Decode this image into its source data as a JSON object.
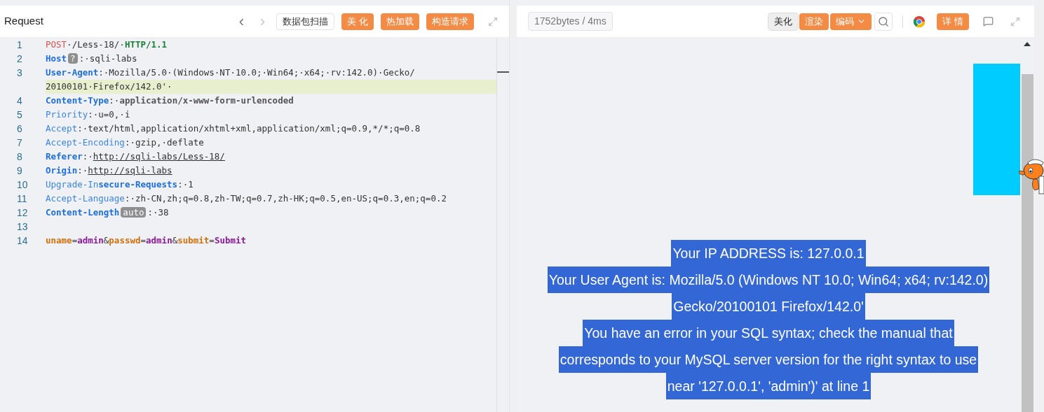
{
  "request": {
    "title": "Request",
    "nav": [
      {
        "label": "‹",
        "disabled": false
      },
      {
        "label": "›",
        "disabled": true
      }
    ],
    "buttons": [
      {
        "label": "数据包扫描",
        "kind": "outline"
      },
      {
        "label": "美 化",
        "kind": "primary"
      },
      {
        "label": "热加载",
        "kind": "primary"
      },
      {
        "label": "构造请求",
        "kind": "primary"
      }
    ],
    "lines": [
      {
        "number": "1",
        "rows": [
          {
            "highlighted": false,
            "segments": [
              {
                "kind": "method",
                "text": "POST"
              },
              {
                "kind": "value",
                "text": "·/Less-18/·"
              },
              {
                "kind": "keyword",
                "text": "HTTP/1.1"
              }
            ]
          }
        ]
      },
      {
        "number": "2",
        "rows": [
          {
            "highlighted": false,
            "segments": [
              {
                "kind": "header",
                "text": "Host"
              },
              {
                "kind": "badge",
                "text": "?"
              },
              {
                "kind": "value",
                "text": ":·sqli-labs"
              }
            ]
          }
        ]
      },
      {
        "number": "3",
        "rows": [
          {
            "highlighted": false,
            "segments": [
              {
                "kind": "header",
                "text": "User-Agent"
              },
              {
                "kind": "value",
                "text": ":·Mozilla/5.0·(Windows·NT·10.0;·Win64;·x64;·rv:142.0)·Gecko/"
              }
            ]
          },
          {
            "highlighted": true,
            "segments": [
              {
                "kind": "value",
                "text": "20100101·Firefox/142.0'·"
              }
            ]
          }
        ]
      },
      {
        "number": "4",
        "rows": [
          {
            "highlighted": false,
            "segments": [
              {
                "kind": "header",
                "text": "Content-Type"
              },
              {
                "kind": "value",
                "text": ":·"
              },
              {
                "kind": "strong",
                "text": "application/x-www-form-urlencoded"
              }
            ]
          }
        ]
      },
      {
        "number": "5",
        "rows": [
          {
            "highlighted": false,
            "segments": [
              {
                "kind": "header-light",
                "text": "Priority"
              },
              {
                "kind": "value",
                "text": ":·u=0,·i"
              }
            ]
          }
        ]
      },
      {
        "number": "6",
        "rows": [
          {
            "highlighted": false,
            "segments": [
              {
                "kind": "header-light",
                "text": "Accept"
              },
              {
                "kind": "value",
                "text": ":·text/html,application/xhtml+xml,application/xml;q=0.9,*/*;q=0.8"
              }
            ]
          }
        ]
      },
      {
        "number": "7",
        "rows": [
          {
            "highlighted": false,
            "segments": [
              {
                "kind": "header-light",
                "text": "Accept-Encoding"
              },
              {
                "kind": "value",
                "text": ":·gzip,·deflate"
              }
            ]
          }
        ]
      },
      {
        "number": "8",
        "rows": [
          {
            "highlighted": false,
            "segments": [
              {
                "kind": "header",
                "text": "Referer"
              },
              {
                "kind": "value",
                "text": ":·"
              },
              {
                "kind": "link",
                "text": "http://sqli-labs/Less-18/"
              }
            ]
          }
        ]
      },
      {
        "number": "9",
        "rows": [
          {
            "highlighted": false,
            "segments": [
              {
                "kind": "header",
                "text": "Origin"
              },
              {
                "kind": "value",
                "text": ":·"
              },
              {
                "kind": "link",
                "text": "http://sqli-labs"
              }
            ]
          }
        ]
      },
      {
        "number": "10",
        "rows": [
          {
            "highlighted": false,
            "segments": [
              {
                "kind": "header-light",
                "text": "Upgrade-In"
              },
              {
                "kind": "header",
                "text": "secure-Requests"
              },
              {
                "kind": "value",
                "text": ":·1"
              }
            ]
          }
        ]
      },
      {
        "number": "11",
        "rows": [
          {
            "highlighted": false,
            "segments": [
              {
                "kind": "header-light",
                "text": "Accept-Language"
              },
              {
                "kind": "value",
                "text": ":·zh-CN,zh;q=0.8,zh-TW;q=0.7,zh-HK;q=0.5,en-US;q=0.3,en;q=0.2"
              }
            ]
          }
        ]
      },
      {
        "number": "12",
        "rows": [
          {
            "highlighted": false,
            "segments": [
              {
                "kind": "header",
                "text": "Content-Length"
              },
              {
                "kind": "badge",
                "text": "auto"
              },
              {
                "kind": "value",
                "text": ":·38"
              }
            ]
          }
        ]
      },
      {
        "number": "13",
        "rows": [
          {
            "highlighted": false,
            "segments": []
          }
        ]
      },
      {
        "number": "14",
        "rows": [
          {
            "highlighted": false,
            "segments": [
              {
                "kind": "param-name",
                "text": "uname"
              },
              {
                "kind": "value",
                "text": "="
              },
              {
                "kind": "param-value",
                "text": "admin"
              },
              {
                "kind": "value",
                "text": "&"
              },
              {
                "kind": "param-name",
                "text": "passwd"
              },
              {
                "kind": "value",
                "text": "="
              },
              {
                "kind": "param-value",
                "text": "admin"
              },
              {
                "kind": "value",
                "text": "&"
              },
              {
                "kind": "param-name",
                "text": "submit"
              },
              {
                "kind": "value",
                "text": "="
              },
              {
                "kind": "param-value",
                "text": "Submit"
              }
            ]
          }
        ]
      }
    ]
  },
  "response": {
    "stats": "1752bytes / 4ms",
    "buttons": [
      {
        "label": "美化",
        "kind": "plain",
        "selected": true
      },
      {
        "label": "渲染",
        "kind": "primary",
        "selected": false
      },
      {
        "label": "编码",
        "kind": "dropdown",
        "selected": false
      }
    ],
    "detail_button": "详 情",
    "output": {
      "selected": true,
      "lines": [
        "Your IP ADDRESS is: 127.0.0.1",
        "Your User Agent is: Mozilla/5.0 (Windows NT 10.0; Win64; x64; rv:142.0)",
        "Gecko/20100101 Firefox/142.0'",
        "You have an error in your SQL syntax; check the manual that",
        "corresponds to your MySQL server version for the right syntax to use",
        "near '127.0.0.1', 'admin')' at line 1"
      ]
    }
  }
}
